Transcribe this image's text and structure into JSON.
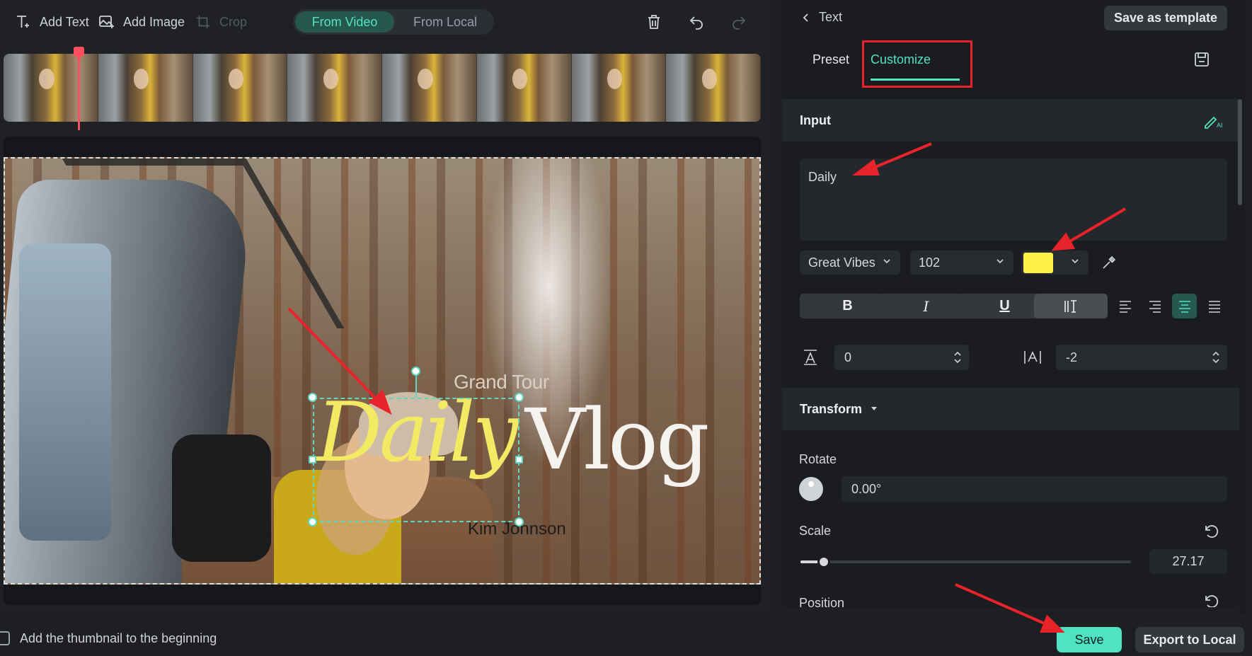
{
  "toolbar": {
    "add_text": "Add Text",
    "add_image": "Add Image",
    "crop": "Crop",
    "from_video": "From Video",
    "from_local": "From Local"
  },
  "canvas": {
    "title_small": "Grand Tour",
    "title_main_1": "Daily",
    "title_main_2": "Vlog",
    "subtitle": "Kim Johnson"
  },
  "footer": {
    "checkbox_label": "Add the thumbnail to the beginning",
    "save": "Save",
    "export": "Export to Local"
  },
  "panel": {
    "back_label": "Text",
    "save_template": "Save as template",
    "tabs": {
      "preset": "Preset",
      "customize": "Customize"
    },
    "input": {
      "heading": "Input",
      "value": "Daily"
    },
    "font": {
      "family": "Great Vibes",
      "size": "102",
      "color": "#FFF14A"
    },
    "format": {
      "bold": "B",
      "italic": "I",
      "underline": "U"
    },
    "spacing": {
      "char_spacing": "0",
      "line_spacing": "-2"
    },
    "transform": {
      "heading": "Transform",
      "rotate_label": "Rotate",
      "rotate_value": "0.00°",
      "scale_label": "Scale",
      "scale_value": "27.17",
      "scale_fraction": 0.07,
      "position_label": "Position"
    }
  },
  "colors": {
    "accent": "#4FE3C3",
    "annotation": "#E8232A",
    "playhead": "#FF4F5E"
  }
}
